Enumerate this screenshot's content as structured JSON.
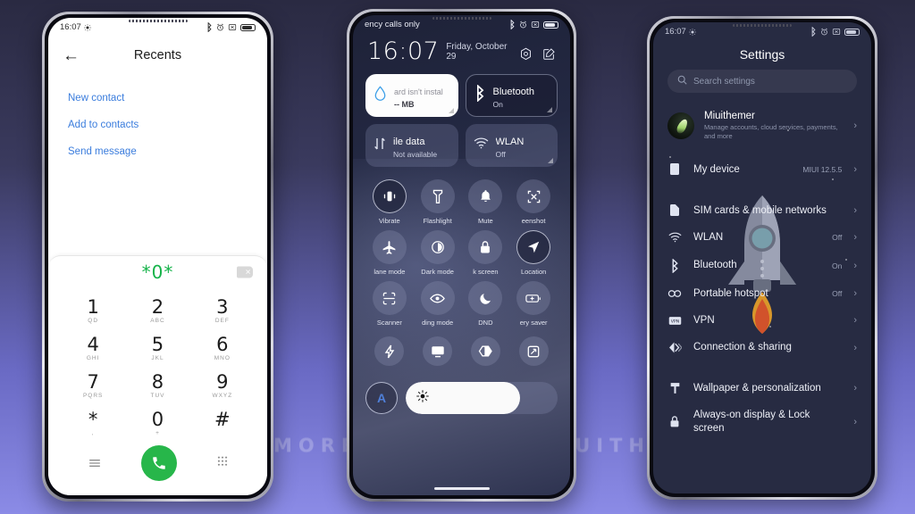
{
  "background": {
    "watermark": "VISIT FOR MORE THEMES - MIUITHEMER.COM",
    "gradient_top": "#2a2a42",
    "gradient_bottom": "#8b8be6"
  },
  "phone1": {
    "status": {
      "time": "16:07",
      "icons": [
        "brightness-icon",
        "bluetooth-icon",
        "alarm-icon",
        "vibrate-icon",
        "battery-icon"
      ]
    },
    "appbar": {
      "back": "←",
      "title": "Recents"
    },
    "actions": [
      {
        "label": "New contact"
      },
      {
        "label": "Add to contacts"
      },
      {
        "label": "Send message"
      }
    ],
    "dialer": {
      "number": "*0*",
      "number_color": "#16b34a",
      "keys": [
        {
          "digit": "1",
          "letters": "QD"
        },
        {
          "digit": "2",
          "letters": "ABC"
        },
        {
          "digit": "3",
          "letters": "DEF"
        },
        {
          "digit": "4",
          "letters": "GHI"
        },
        {
          "digit": "5",
          "letters": "JKL"
        },
        {
          "digit": "6",
          "letters": "MNO"
        },
        {
          "digit": "7",
          "letters": "PQRS"
        },
        {
          "digit": "8",
          "letters": "TUV"
        },
        {
          "digit": "9",
          "letters": "WXYZ"
        },
        {
          "digit": "*",
          "letters": ","
        },
        {
          "digit": "0",
          "letters": "+"
        },
        {
          "digit": "#",
          "letters": ""
        }
      ],
      "call_button": "call-icon",
      "left_icon": "menu-icon",
      "right_icon": "keypad-icon"
    }
  },
  "phone2": {
    "status": {
      "carrier": "ency calls only",
      "icons": [
        "bluetooth-icon",
        "alarm-icon",
        "vibrate-icon",
        "battery-icon"
      ]
    },
    "clock": {
      "time": "16:07",
      "date": "Friday, October 29",
      "action_settings": "settings-icon",
      "action_edit": "edit-icon"
    },
    "big_tiles": [
      {
        "name": "sd-card",
        "title": "ard isn't instal",
        "sub": "-- MB",
        "style": "light",
        "icon": "water-drop-icon"
      },
      {
        "name": "bluetooth",
        "title": "Bluetooth",
        "sub": "On",
        "style": "dark",
        "icon": "bluetooth-icon"
      },
      {
        "name": "mobile-data",
        "title": "ile data",
        "sub": "Not available",
        "style": "plain",
        "icon": "data-arrows-icon"
      },
      {
        "name": "wlan",
        "title": "WLAN",
        "sub": "Off",
        "style": "plain",
        "icon": "wifi-icon"
      }
    ],
    "toggles": [
      {
        "label": "Vibrate",
        "icon": "vibrate-icon",
        "on": true
      },
      {
        "label": "Flashlight",
        "icon": "flashlight-icon",
        "on": false
      },
      {
        "label": "Mute",
        "icon": "bell-icon",
        "on": false
      },
      {
        "label": "eenshot",
        "icon": "screenshot-icon",
        "on": false
      },
      {
        "label": "lane mode",
        "icon": "airplane-icon",
        "on": false
      },
      {
        "label": "Dark mode",
        "icon": "dark-mode-icon",
        "on": false
      },
      {
        "label": "k screen",
        "icon": "lock-icon",
        "on": false
      },
      {
        "label": "Location",
        "icon": "location-icon",
        "on": true
      },
      {
        "label": "Scanner",
        "icon": "scanner-icon",
        "on": false
      },
      {
        "label": "ding mode",
        "icon": "eye-icon",
        "on": false
      },
      {
        "label": "DND",
        "icon": "moon-icon",
        "on": false
      },
      {
        "label": "ery saver",
        "icon": "battery-saver-icon",
        "on": false
      }
    ],
    "mini_toggles": [
      {
        "label": "",
        "icon": "lightning-icon"
      },
      {
        "label": "",
        "icon": "cast-icon"
      },
      {
        "label": "",
        "icon": "contrast-icon"
      },
      {
        "label": "",
        "icon": "expand-icon"
      }
    ],
    "brightness": {
      "auto_label": "A",
      "value_percent": 75,
      "icon": "sun-icon"
    }
  },
  "phone3": {
    "status": {
      "time": "16:07",
      "icons": [
        "brightness-icon",
        "bluetooth-icon",
        "alarm-icon",
        "vibrate-icon",
        "battery-icon"
      ]
    },
    "title": "Settings",
    "search": {
      "placeholder": "Search settings",
      "icon": "search-icon"
    },
    "account": {
      "name": "Miuithemer",
      "sub": "Manage accounts, cloud services, payments, and more",
      "avatar": "avatar"
    },
    "rows_group1": [
      {
        "label": "My device",
        "value": "MIUI 12.5.5",
        "icon": "device-icon"
      }
    ],
    "rows_group2": [
      {
        "label": "SIM cards & mobile networks",
        "value": "",
        "icon": "sim-icon"
      },
      {
        "label": "WLAN",
        "value": "Off",
        "icon": "wifi-icon"
      },
      {
        "label": "Bluetooth",
        "value": "On",
        "icon": "bluetooth-icon"
      },
      {
        "label": "Portable hotspot",
        "value": "Off",
        "icon": "hotspot-icon"
      },
      {
        "label": "VPN",
        "value": "",
        "icon": "vpn-icon"
      },
      {
        "label": "Connection & sharing",
        "value": "",
        "icon": "sharing-icon"
      }
    ],
    "rows_group3": [
      {
        "label": "Wallpaper & personalization",
        "value": "",
        "icon": "wallpaper-icon"
      },
      {
        "label": "Always-on display & Lock screen",
        "value": "",
        "icon": "lock-icon"
      }
    ]
  }
}
